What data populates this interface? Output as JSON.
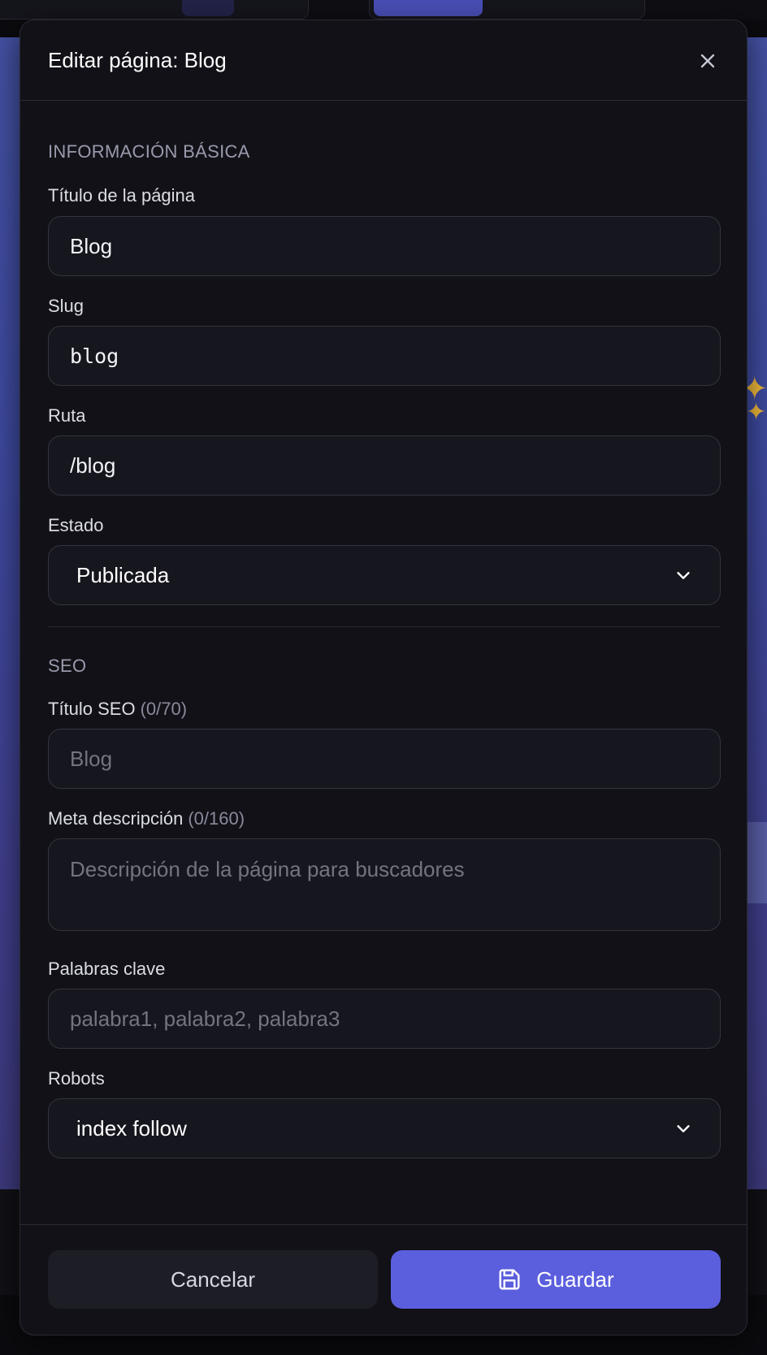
{
  "modal": {
    "title": "Editar página: Blog",
    "sections": {
      "basic": "INFORMACIÓN BÁSICA",
      "seo": "SEO"
    },
    "fields": {
      "page_title": {
        "label": "Título de la página",
        "value": "Blog"
      },
      "slug": {
        "label": "Slug",
        "value": "blog"
      },
      "route": {
        "label": "Ruta",
        "value": "/blog"
      },
      "status": {
        "label": "Estado",
        "value": "Publicada"
      },
      "seo_title": {
        "label": "Título SEO",
        "counter": "(0/70)",
        "placeholder": "Blog"
      },
      "meta_description": {
        "label": "Meta descripción",
        "counter": "(0/160)",
        "placeholder": "Descripción de la página para buscadores"
      },
      "keywords": {
        "label": "Palabras clave",
        "placeholder": "palabra1, palabra2, palabra3"
      },
      "robots": {
        "label": "Robots",
        "value": "index follow"
      }
    },
    "footer": {
      "cancel_label": "Cancelar",
      "save_label": "Guardar"
    }
  },
  "colors": {
    "accent": "#5b5fdd",
    "modal_bg": "#111117",
    "input_bg": "#16161e",
    "canvas_bg": "#4452a4"
  },
  "icons": [
    "close-icon",
    "chevron-down-icon",
    "save-icon"
  ]
}
